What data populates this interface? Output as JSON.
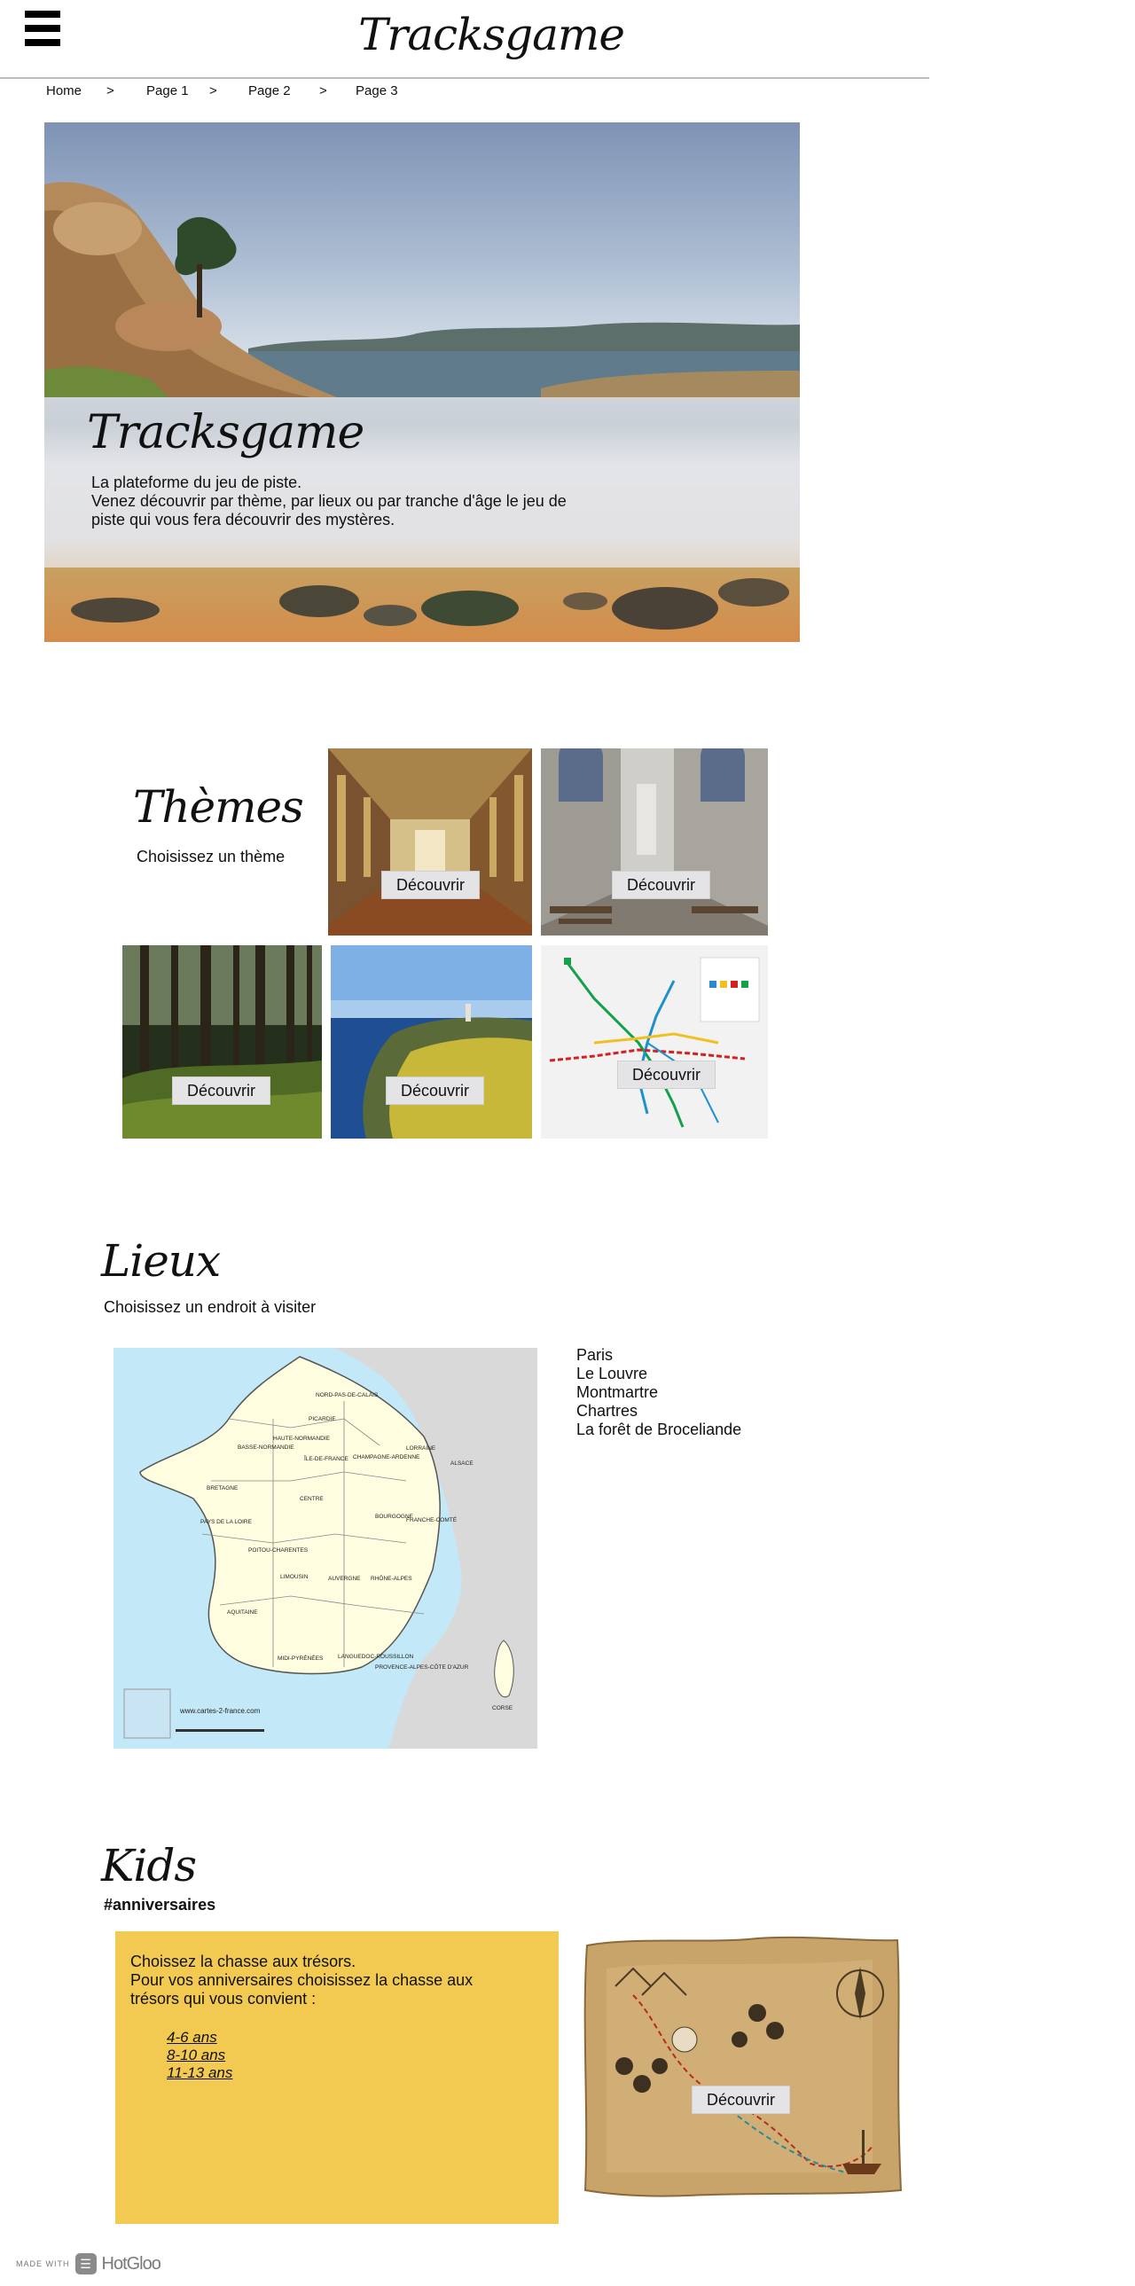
{
  "header": {
    "menu_icon": "hamburger-menu-icon",
    "site_title": "Tracksgame"
  },
  "breadcrumb": {
    "items": [
      "Home",
      "Page 1",
      "Page 2",
      "Page 3"
    ],
    "separator": ">"
  },
  "hero": {
    "title": "Tracksgame",
    "lines": [
      "La plateforme du jeu de piste.",
      "Venez découvrir par thème, par lieux ou par tranche d'âge le jeu de",
      "piste qui vous fera découvrir des mystères."
    ]
  },
  "themes": {
    "title": "Thèmes",
    "subtitle": "Choisissez un thème",
    "button_label": "Découvrir"
  },
  "lieux": {
    "title": "Lieux",
    "subtitle": "Choisissez un endroit à visiter",
    "places": [
      "Paris",
      "Le Louvre",
      "Montmartre",
      "Chartres",
      "La forêt de Broceliande"
    ],
    "map": {
      "regions": [
        "NORD-PAS-DE-CALAIS",
        "PICARDIE",
        "HAUTE-NORMANDIE",
        "BASSE-NORMANDIE",
        "ÎLE-DE-FRANCE",
        "CHAMPAGNE-ARDENNE",
        "LORRAINE",
        "ALSACE",
        "BRETAGNE",
        "CENTRE",
        "PAYS DE LA LOIRE",
        "BOURGOGNE",
        "FRANCHE-COMTÉ",
        "POITOU-CHARENTES",
        "LIMOUSIN",
        "AUVERGNE",
        "RHÔNE-ALPES",
        "AQUITAINE",
        "MIDI-PYRÉNÉES",
        "LANGUEDOC-ROUSSILLON",
        "PROVENCE-ALPES-CÔTE D'AZUR",
        "CORSE"
      ],
      "credit": "www.cartes-2-france.com"
    }
  },
  "kids": {
    "title": "Kids",
    "hashtag": "#anniversaires",
    "lines": [
      "Choissez la chasse aux trésors.",
      "Pour vos anniversaires choisissez la chasse aux",
      "trésors qui vous convient :"
    ],
    "ages": [
      "4-6 ans",
      "8-10 ans",
      "11-13 ans"
    ],
    "button_label": "Découvrir"
  },
  "footer": {
    "made_with": "MADE WITH",
    "brand": "HotGloo"
  },
  "colors": {
    "kids_box": "#f2ca52",
    "button_bg": "#e4e4e6",
    "rule": "#bdbdbd"
  }
}
